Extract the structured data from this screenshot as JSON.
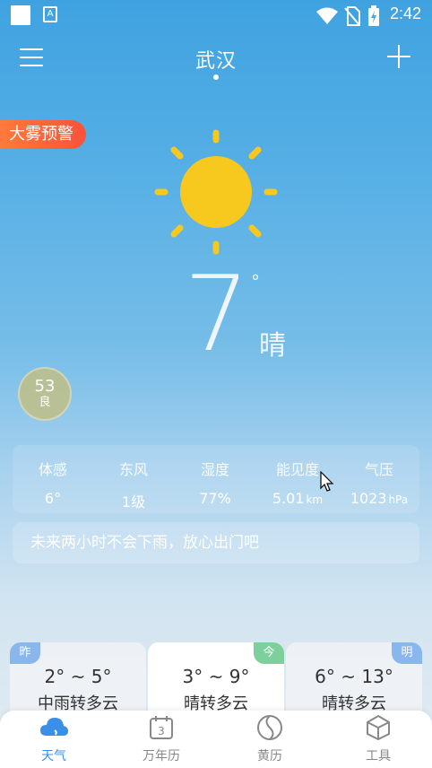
{
  "status": {
    "time": "2:42"
  },
  "header": {
    "city": "武汉"
  },
  "alert": {
    "label": "大雾预警"
  },
  "current": {
    "temperature": "7",
    "degree": "°",
    "condition": "晴"
  },
  "aqi": {
    "value": "53",
    "level": "良"
  },
  "details": [
    {
      "label": "体感",
      "value": "6°",
      "unit": ""
    },
    {
      "label": "东风",
      "value": "1级",
      "unit": ""
    },
    {
      "label": "湿度",
      "value": "77%",
      "unit": ""
    },
    {
      "label": "能见度",
      "value": "5.01",
      "unit": "km"
    },
    {
      "label": "气压",
      "value": "1023",
      "unit": "hPa"
    }
  ],
  "forecast_text": "未来两小时不会下雨，放心出门吧",
  "days": [
    {
      "tag": "昨",
      "temp": "2° ~ 5°",
      "condition": "中雨转多云"
    },
    {
      "tag": "今",
      "temp": "3° ~ 9°",
      "condition": "晴转多云"
    },
    {
      "tag": "明",
      "temp": "6° ~ 13°",
      "condition": "晴转多云"
    }
  ],
  "tabs": [
    {
      "label": "天气",
      "icon": "cloud-icon",
      "active": true
    },
    {
      "label": "万年历",
      "icon": "calendar-icon",
      "calendar_day": "3"
    },
    {
      "label": "黄历",
      "icon": "yin-yang-icon"
    },
    {
      "label": "工具",
      "icon": "cube-icon"
    }
  ],
  "colors": {
    "accent": "#3a8fe8",
    "alert": "#f8533a",
    "sun": "#f7c81e",
    "today_tag": "#7dcf9c",
    "day_tag": "#8ab6ee"
  }
}
